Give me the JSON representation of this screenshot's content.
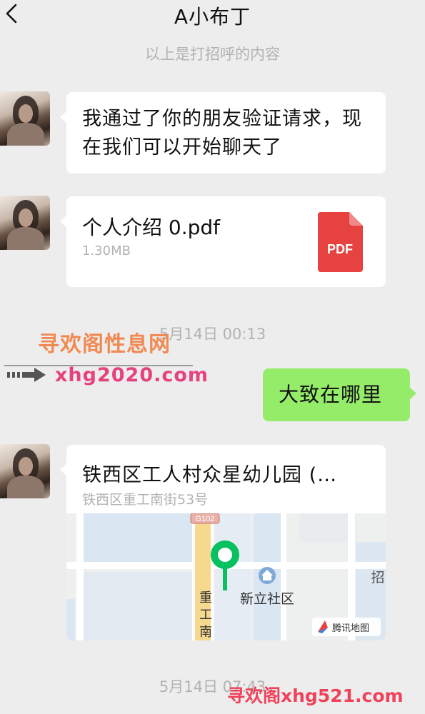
{
  "header": {
    "title": "A小布丁",
    "back_icon": "chevron-left-icon"
  },
  "messages": {
    "greeting_notice": "以上是打招呼的内容",
    "msg1": {
      "line1": "我通过了你的朋友验证请求，现",
      "line2": "在我们可以开始聊天了"
    },
    "file": {
      "name": "个人介绍 0.pdf",
      "size": "1.30MB",
      "icon_label": "PDF",
      "icon_color": "#e64340"
    },
    "timestamp1": "5月14日 00:13",
    "reply": "大致在哪里",
    "location": {
      "title": "铁西区工人村众星幼儿园 (…",
      "address": "铁西区重工南街53号",
      "map": {
        "road_badge": "G102",
        "road_name_1": "重",
        "road_name_2": "工",
        "road_name_3": "南",
        "poi_label": "新立社区",
        "edge_label": "招",
        "provider": "腾讯地图",
        "pin_color": "#07c160"
      }
    },
    "timestamp2": "5月14日 07:43"
  },
  "watermarks": {
    "top_text": "寻欢阁性息网",
    "top_url": "xhg2020.com",
    "bottom_text": "寻欢阁xhg521.com"
  },
  "colors": {
    "background": "#ededed",
    "bubble_self": "#95ec69",
    "bubble_other": "#ffffff"
  }
}
